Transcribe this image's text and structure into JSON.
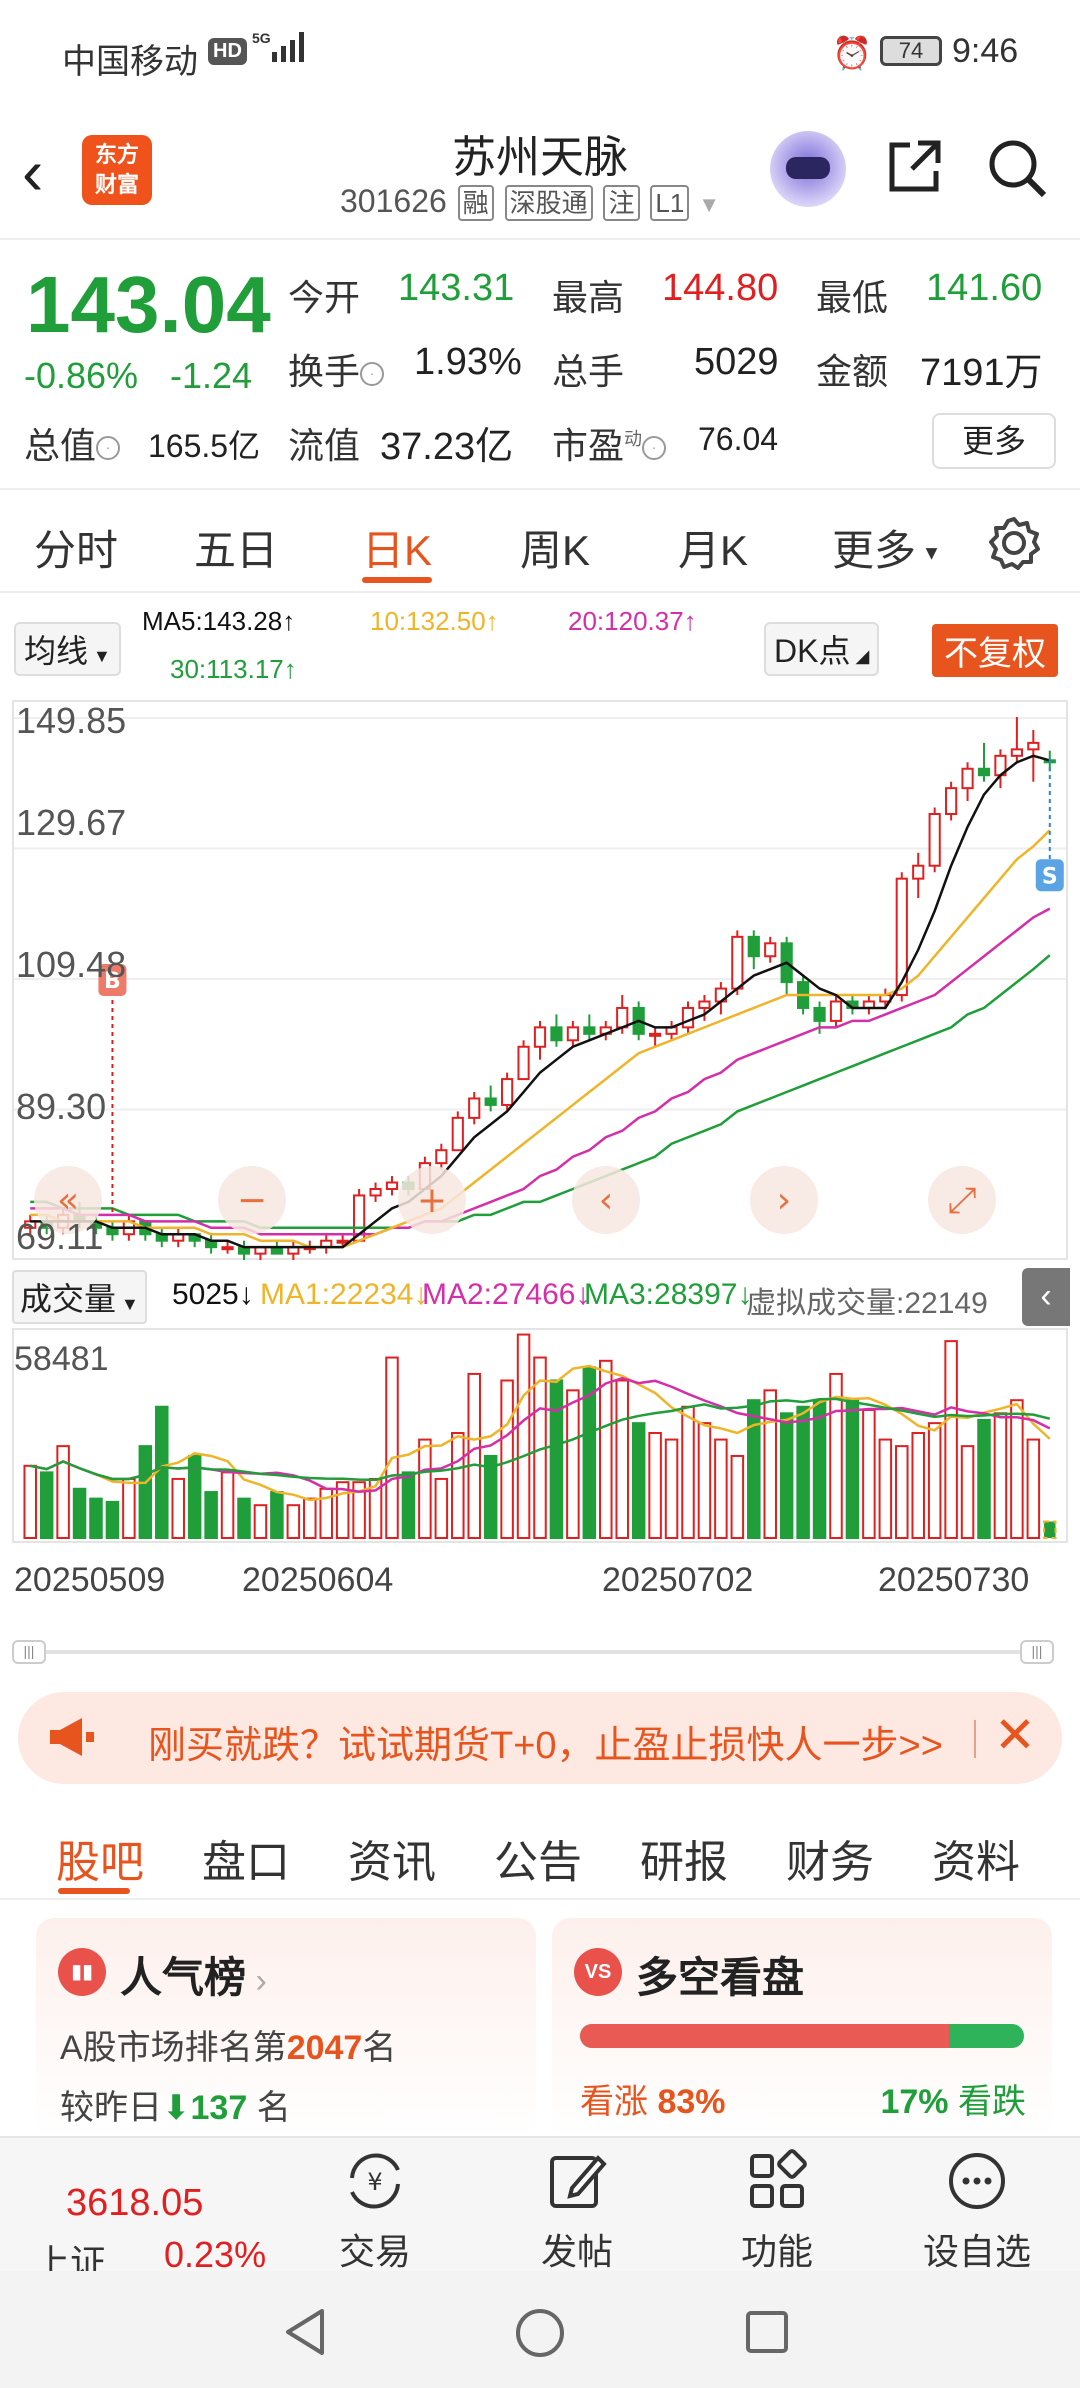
{
  "status_bar": {
    "carrier": "中国移动",
    "hd": "HD",
    "signal": "5G",
    "battery": "74",
    "time": "9:46"
  },
  "header": {
    "logo_line1": "东方",
    "logo_line2": "财富",
    "title": "苏州天脉",
    "code": "301626",
    "tags": [
      "融",
      "深股通",
      "注",
      "L1"
    ]
  },
  "quote": {
    "price": "143.04",
    "change_pct": "-0.86%",
    "change": "-1.24",
    "open_label": "今开",
    "open": "143.31",
    "high_label": "最高",
    "high": "144.80",
    "low_label": "最低",
    "low": "141.60",
    "turnover_label": "换手",
    "turnover": "1.93%",
    "volume_label": "总手",
    "volume": "5029",
    "amount_label": "金额",
    "amount": "7191万",
    "mktcap_label": "总值",
    "mktcap": "165.5亿",
    "float_label": "流值",
    "float": "37.23亿",
    "pe_label": "市盈",
    "pe_sup": "动",
    "pe": "76.04",
    "more": "更多"
  },
  "chart_tabs": [
    "分时",
    "五日",
    "日K",
    "周K",
    "月K",
    "更多"
  ],
  "active_chart_tab": "日K",
  "ma_legend": {
    "selector": "均线",
    "ma5": "MA5:143.28↑",
    "ma10": "10:132.50↑",
    "ma20": "20:120.37↑",
    "ma30": "30:113.17↑",
    "dk": "DK点",
    "fq": "不复权"
  },
  "colors": {
    "up": "#e02020",
    "down": "#1f9e3a",
    "accent": "#e8541e",
    "ma5": "#111111",
    "ma10": "#f0b429",
    "ma20": "#d42ea8",
    "ma30": "#1f9e3a"
  },
  "chart_data": {
    "type": "candlestick",
    "y_ticks": [
      "149.85",
      "129.67",
      "109.48",
      "89.30",
      "69.11"
    ],
    "ylim": [
      69.11,
      149.85
    ],
    "markers": {
      "buy": "B",
      "sell": "S"
    },
    "candles": [
      [
        71,
        73,
        70,
        72
      ],
      [
        72,
        73,
        70,
        71
      ],
      [
        71,
        74,
        70,
        73
      ],
      [
        73,
        75,
        71,
        72
      ],
      [
        72,
        73,
        70,
        71
      ],
      [
        71,
        72,
        69,
        70
      ],
      [
        70,
        73,
        69,
        72
      ],
      [
        72,
        72,
        69,
        70
      ],
      [
        70,
        71,
        68,
        69
      ],
      [
        69,
        71,
        68,
        70
      ],
      [
        70,
        70,
        68,
        69
      ],
      [
        69,
        70,
        67,
        68
      ],
      [
        68,
        69,
        67,
        68
      ],
      [
        68,
        69,
        66,
        67
      ],
      [
        67,
        68,
        66,
        68
      ],
      [
        68,
        69,
        67,
        67
      ],
      [
        67,
        69,
        66,
        68
      ],
      [
        68,
        69,
        67,
        68
      ],
      [
        68,
        70,
        67,
        69
      ],
      [
        69,
        70,
        68,
        69
      ],
      [
        69,
        77,
        69,
        76
      ],
      [
        76,
        78,
        75,
        77
      ],
      [
        77,
        79,
        76,
        78
      ],
      [
        78,
        79,
        76,
        77
      ],
      [
        77,
        82,
        77,
        81
      ],
      [
        81,
        84,
        80,
        83
      ],
      [
        83,
        89,
        83,
        88
      ],
      [
        88,
        92,
        87,
        91
      ],
      [
        91,
        93,
        89,
        90
      ],
      [
        90,
        95,
        89,
        94
      ],
      [
        94,
        100,
        94,
        99
      ],
      [
        99,
        103,
        97,
        102
      ],
      [
        102,
        104,
        99,
        100
      ],
      [
        100,
        103,
        99,
        102
      ],
      [
        102,
        104,
        100,
        101
      ],
      [
        101,
        103,
        100,
        102
      ],
      [
        102,
        107,
        101,
        105
      ],
      [
        105,
        106,
        100,
        101
      ],
      [
        101,
        102,
        99,
        101
      ],
      [
        101,
        103,
        100,
        102
      ],
      [
        102,
        106,
        101,
        105
      ],
      [
        105,
        107,
        103,
        106
      ],
      [
        106,
        109,
        104,
        108
      ],
      [
        108,
        117,
        107,
        116
      ],
      [
        116,
        117,
        111,
        113
      ],
      [
        113,
        116,
        112,
        115
      ],
      [
        115,
        116,
        107,
        109
      ],
      [
        109,
        110,
        104,
        105
      ],
      [
        105,
        106,
        101,
        103
      ],
      [
        103,
        107,
        102,
        106
      ],
      [
        106,
        107,
        104,
        105
      ],
      [
        105,
        107,
        104,
        106
      ],
      [
        106,
        108,
        105,
        107
      ],
      [
        107,
        126,
        106,
        125
      ],
      [
        125,
        129,
        122,
        127
      ],
      [
        127,
        136,
        126,
        135
      ],
      [
        135,
        140,
        134,
        139
      ],
      [
        139,
        143,
        137,
        142
      ],
      [
        142,
        146,
        140,
        141
      ],
      [
        141,
        145,
        139,
        144
      ],
      [
        144,
        150,
        143,
        145
      ],
      [
        145,
        148,
        140,
        146
      ],
      [
        143.31,
        144.8,
        141.6,
        143.04
      ]
    ],
    "ma5": [
      72,
      72,
      72,
      72,
      72,
      71,
      71,
      71,
      70,
      70,
      70,
      69,
      69,
      68,
      68,
      68,
      68,
      68,
      68,
      68,
      70,
      72,
      74,
      75,
      77,
      79,
      82,
      85,
      87,
      89,
      92,
      95,
      97,
      99,
      100,
      101,
      102,
      103,
      102,
      102,
      103,
      104,
      106,
      108,
      110,
      111,
      112,
      110,
      108,
      107,
      105,
      105,
      105,
      109,
      114,
      120,
      127,
      133,
      138,
      141,
      143,
      144,
      143.28
    ],
    "ma10": [
      73,
      73,
      72,
      72,
      72,
      72,
      72,
      71,
      71,
      71,
      71,
      70,
      70,
      70,
      69,
      69,
      69,
      68,
      68,
      68,
      69,
      70,
      71,
      72,
      73,
      74,
      76,
      78,
      80,
      82,
      84,
      86,
      88,
      90,
      92,
      94,
      96,
      98,
      99,
      100,
      101,
      102,
      103,
      104,
      105,
      106,
      107,
      107,
      107,
      107,
      107,
      107,
      107,
      108,
      110,
      113,
      116,
      119,
      122,
      125,
      128,
      130,
      132.5
    ],
    "ma20": [
      74,
      74,
      74,
      73,
      73,
      73,
      73,
      72,
      72,
      72,
      72,
      71,
      71,
      71,
      70,
      70,
      70,
      70,
      70,
      70,
      70,
      70,
      71,
      71,
      72,
      72,
      73,
      74,
      75,
      76,
      77,
      79,
      80,
      82,
      83,
      85,
      86,
      88,
      89,
      91,
      92,
      94,
      95,
      97,
      98,
      99,
      100,
      101,
      102,
      102,
      103,
      103,
      104,
      105,
      106,
      107,
      109,
      111,
      113,
      115,
      117,
      119,
      120.37
    ],
    "ma30": [
      75,
      75,
      74,
      74,
      74,
      74,
      73,
      73,
      73,
      73,
      72,
      72,
      72,
      72,
      71,
      71,
      71,
      71,
      71,
      71,
      71,
      71,
      71,
      71,
      72,
      72,
      72,
      73,
      73,
      74,
      75,
      75,
      76,
      77,
      78,
      79,
      80,
      81,
      82,
      84,
      85,
      86,
      87,
      89,
      90,
      91,
      92,
      93,
      94,
      95,
      96,
      97,
      98,
      99,
      100,
      101,
      102,
      104,
      105,
      107,
      109,
      111,
      113.17
    ]
  },
  "volume": {
    "selector": "成交量",
    "cur": "5025↓",
    "ma1": "MA1:22234↓",
    "ma2": "MA2:27466↓",
    "ma3": "MA3:28397↓",
    "virtual": "虚拟成交量:22149",
    "max_label": "58481",
    "max": 58481,
    "bars": [
      22000,
      20000,
      28000,
      15000,
      12000,
      11000,
      18000,
      28000,
      40000,
      18000,
      25000,
      14000,
      20000,
      12000,
      10000,
      14000,
      10000,
      12000,
      15000,
      17000,
      17000,
      18000,
      55000,
      20000,
      30000,
      18000,
      32000,
      50000,
      25000,
      48000,
      62000,
      55000,
      48000,
      45000,
      52000,
      54000,
      48000,
      35000,
      32000,
      30000,
      40000,
      35000,
      30000,
      25000,
      42000,
      45000,
      38000,
      40000,
      42000,
      50000,
      42000,
      39000,
      30000,
      28000,
      32000,
      35000,
      60000,
      28000,
      36000,
      38000,
      42000,
      30000,
      5025
    ],
    "dates": [
      "20250509",
      "20250604",
      "20250702",
      "20250730"
    ]
  },
  "banner": {
    "text": "刚买就跌？试试期货T+0，止盈止损快人一步>>",
    "close": "✕"
  },
  "content_tabs": [
    "股吧",
    "盘口",
    "资讯",
    "公告",
    "研报",
    "财务",
    "资料"
  ],
  "active_content_tab": "股吧",
  "card_popular": {
    "title": "人气榜",
    "line1_prefix": "A股市场排名第",
    "rank": "2047",
    "line1_suffix": "名",
    "line2_prefix": "较昨日",
    "change": "137",
    "line2_suffix": "名"
  },
  "card_bullbear": {
    "title": "多空看盘",
    "icon": "VS",
    "up_label": "看涨",
    "up_pct": "83%",
    "down_pct": "17%",
    "down_label": "看跌",
    "up_ratio": 0.83
  },
  "bottom_nav": {
    "index_value": "3618.05",
    "index_name": "上证",
    "index_pct": "0.23%",
    "items": [
      "交易",
      "发帖",
      "功能",
      "设自选"
    ]
  }
}
